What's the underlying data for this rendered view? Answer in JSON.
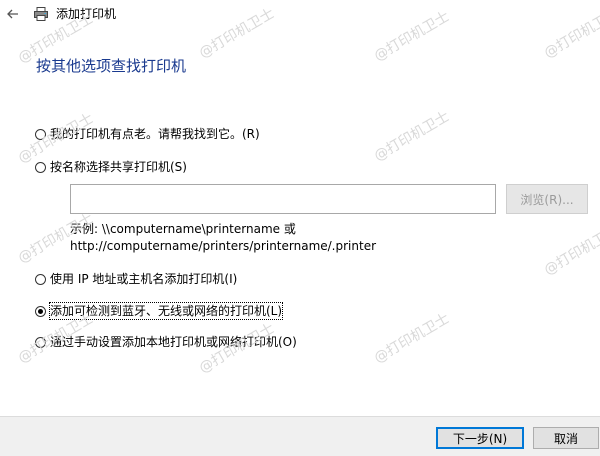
{
  "window": {
    "title": "添加打印机"
  },
  "page": {
    "heading": "按其他选项查找打印机"
  },
  "options": [
    {
      "label": "我的打印机有点老。请帮我找到它。(R)",
      "checked": false
    },
    {
      "label": "按名称选择共享打印机(S)",
      "checked": false
    },
    {
      "label": "使用 IP 地址或主机名添加打印机(I)",
      "checked": false
    },
    {
      "label": "添加可检测到蓝牙、无线或网络的打印机(L)",
      "checked": true
    },
    {
      "label": "通过手动设置添加本地打印机或网络打印机(O)",
      "checked": false
    }
  ],
  "shared_printer": {
    "value": "",
    "browse_label": "浏览(R)...",
    "example_line1": "示例: \\\\computername\\printername 或",
    "example_line2": "http://computername/printers/printername/.printer"
  },
  "footer": {
    "next_label": "下一步(N)",
    "cancel_label": "取消"
  },
  "watermark": {
    "text": "@打印机卫士"
  },
  "colors": {
    "heading": "#1a3a8f",
    "default_button_border": "#0078d7"
  }
}
